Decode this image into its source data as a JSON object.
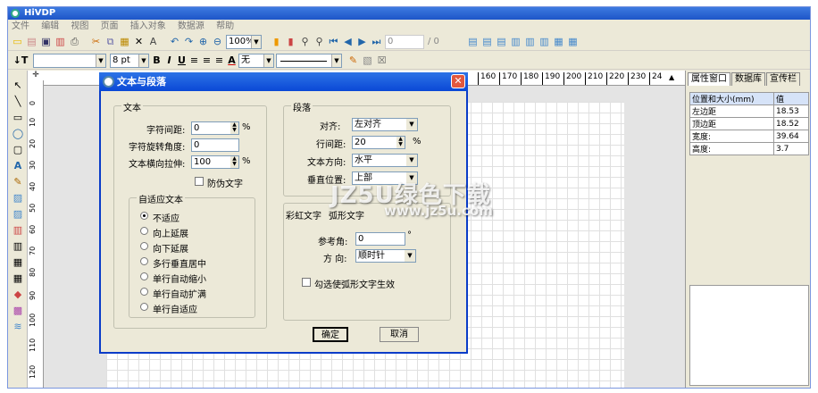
{
  "app": {
    "title": "HiVDP",
    "menu": [
      "文件",
      "编辑",
      "视图",
      "页面",
      "插入对象",
      "数据源",
      "帮助"
    ]
  },
  "toolbar1": {
    "zoom": "100%",
    "page_current": "0",
    "page_total": "/ 0"
  },
  "toolbar2": {
    "text_tool": "↓T",
    "font_size": "8 pt",
    "bold": "B",
    "italic": "I",
    "underline": "U",
    "font_color": "A",
    "border_select": "无"
  },
  "ruler": {
    "h_ticks": [
      "160",
      "170",
      "180",
      "190",
      "200",
      "210",
      "220",
      "230",
      "24"
    ],
    "v_ticks": [
      "0",
      "10",
      "20",
      "30",
      "40",
      "50",
      "60",
      "70",
      "80",
      "90",
      "100",
      "110",
      "120"
    ]
  },
  "right_panel": {
    "tabs": [
      "属性窗口",
      "数据库",
      "宣传栏"
    ],
    "header": [
      "位置和大小(mm)",
      "值"
    ],
    "rows": [
      {
        "name": "左边距",
        "value": "18.53"
      },
      {
        "name": "顶边距",
        "value": "18.52"
      },
      {
        "name": "宽度:",
        "value": "39.64"
      },
      {
        "name": "高度:",
        "value": "3.7"
      }
    ]
  },
  "dialog": {
    "title": "文本与段落",
    "text_group": {
      "label": "文本",
      "char_spacing_label": "字符间距:",
      "char_spacing_value": "0",
      "char_spacing_unit": "%",
      "char_rotation_label": "字符旋转角度:",
      "char_rotation_value": "0",
      "h_stretch_label": "文本横向拉伸:",
      "h_stretch_value": "100",
      "h_stretch_unit": "%",
      "fake_bold_label": "□ 防伪文字",
      "fake_bold_text": "防伪文字"
    },
    "adaptive_group": {
      "label": "自适应文本",
      "options": [
        "不适应",
        "向上延展",
        "向下延展",
        "多行垂直居中",
        "单行自动缩小",
        "单行自动扩满",
        "单行自适应"
      ],
      "selected": 0
    },
    "para_group": {
      "label": "段落",
      "align_label": "对齐:",
      "align_value": "左对齐",
      "line_spacing_label": "行间距:",
      "line_spacing_value": "20",
      "line_spacing_unit": "%",
      "direction_label": "文本方向:",
      "direction_value": "水平",
      "vpos_label": "垂直位置:",
      "vpos_value": "上部"
    },
    "arc_group": {
      "tab1": "彩虹文字",
      "tab2": "弧形文字",
      "ref_angle_label": "参考角:",
      "ref_angle_value": "0",
      "ref_angle_unit": "°",
      "direction_label": "方 向:",
      "direction_value": "顺时针",
      "enable_label": "勾选使弧形文字生效"
    },
    "ok": "确定",
    "cancel": "取消"
  },
  "watermark": {
    "line1": "JZ5U绿色下载",
    "line2": "www.jz5u.com"
  }
}
